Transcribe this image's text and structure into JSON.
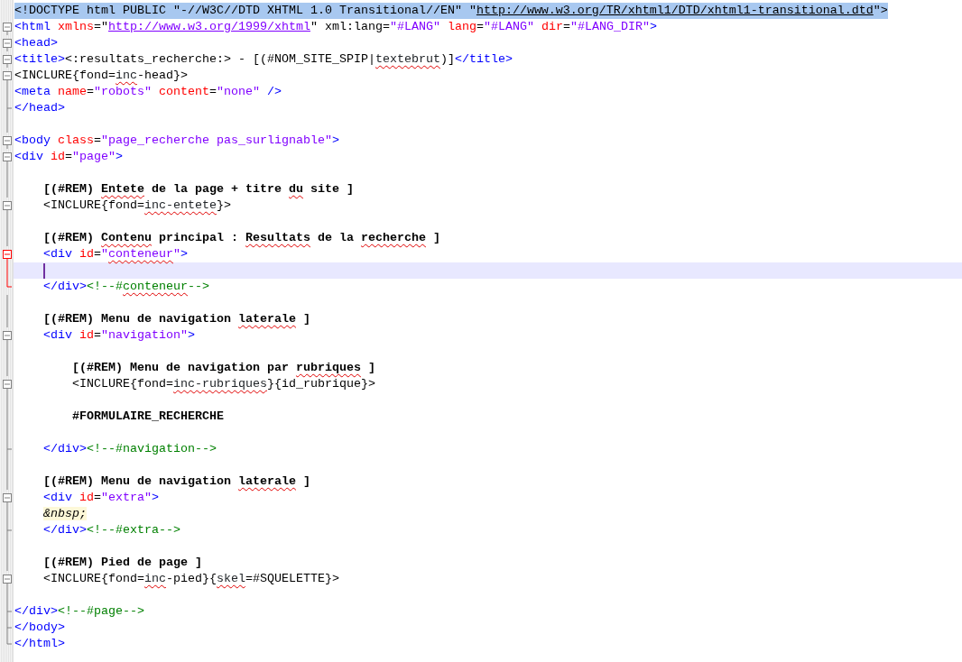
{
  "editor": {
    "lines": [
      {
        "kind": "none",
        "selected": true,
        "current": false,
        "tokens": [
          {
            "kind": "plain",
            "text": "<!DOCTYPE html PUBLIC \"-//W3C//DTD XHTML 1.0 Transitional//EN\" \""
          },
          {
            "kind": "link",
            "text": "http://www.w3.org/TR/xhtml1/DTD/xhtml1-transitional.dtd"
          },
          {
            "kind": "plain",
            "text": "\">"
          }
        ]
      },
      {
        "kind": "open",
        "selected": false,
        "current": false,
        "tokens": [
          {
            "kind": "tag",
            "text": "<html"
          },
          {
            "kind": "attr",
            "text": " xmlns"
          },
          {
            "kind": "plain",
            "text": "=\""
          },
          {
            "kind": "urlstring",
            "text": "http://www.w3.org/1999/xhtml"
          },
          {
            "kind": "plain",
            "text": "\" xml:lang="
          },
          {
            "kind": "string",
            "text": "\"#LANG\""
          },
          {
            "kind": "attr",
            "text": " lang"
          },
          {
            "kind": "plain",
            "text": "="
          },
          {
            "kind": "string",
            "text": "\"#LANG\""
          },
          {
            "kind": "attr",
            "text": " dir"
          },
          {
            "kind": "plain",
            "text": "="
          },
          {
            "kind": "string",
            "text": "\"#LANG_DIR\""
          },
          {
            "kind": "tag",
            "text": ">"
          }
        ]
      },
      {
        "kind": "open",
        "selected": false,
        "current": false,
        "tokens": [
          {
            "kind": "tag",
            "text": "<head>"
          }
        ]
      },
      {
        "kind": "open",
        "selected": false,
        "current": false,
        "tokens": [
          {
            "kind": "tag",
            "text": "<title>"
          },
          {
            "kind": "plain",
            "text": "<:resultats_recherche:> - [(#NOM_SITE_SPIP|"
          },
          {
            "kind": "typo",
            "text": "textebrut"
          },
          {
            "kind": "plain",
            "text": ")]"
          },
          {
            "kind": "tag",
            "text": "</title>"
          }
        ]
      },
      {
        "kind": "open",
        "selected": false,
        "current": false,
        "tokens": [
          {
            "kind": "plain",
            "text": "<INCLURE{fond="
          },
          {
            "kind": "typo",
            "text": "inc"
          },
          {
            "kind": "plain",
            "text": "-head}>"
          }
        ]
      },
      {
        "kind": "line",
        "selected": false,
        "current": false,
        "tokens": [
          {
            "kind": "tag",
            "text": "<meta"
          },
          {
            "kind": "attr",
            "text": " name"
          },
          {
            "kind": "plain",
            "text": "="
          },
          {
            "kind": "string",
            "text": "\"robots\""
          },
          {
            "kind": "attr",
            "text": " content"
          },
          {
            "kind": "plain",
            "text": "="
          },
          {
            "kind": "string",
            "text": "\"none\""
          },
          {
            "kind": "tag",
            "text": " />"
          }
        ]
      },
      {
        "kind": "tick",
        "selected": false,
        "current": false,
        "tokens": [
          {
            "kind": "tag",
            "text": "</head>"
          }
        ]
      },
      {
        "kind": "line",
        "selected": false,
        "current": false
      },
      {
        "kind": "open",
        "selected": false,
        "current": false,
        "tokens": [
          {
            "kind": "tag",
            "text": "<body"
          },
          {
            "kind": "attr",
            "text": " class"
          },
          {
            "kind": "plain",
            "text": "="
          },
          {
            "kind": "string",
            "text": "\"page_recherche pas_surlignable\""
          },
          {
            "kind": "tag",
            "text": ">"
          }
        ]
      },
      {
        "kind": "open",
        "selected": false,
        "current": false,
        "tokens": [
          {
            "kind": "tag",
            "text": "<div"
          },
          {
            "kind": "attr",
            "text": " id"
          },
          {
            "kind": "plain",
            "text": "="
          },
          {
            "kind": "string",
            "text": "\"page\""
          },
          {
            "kind": "tag",
            "text": ">"
          }
        ]
      },
      {
        "kind": "line",
        "selected": false,
        "current": false
      },
      {
        "kind": "line",
        "selected": false,
        "current": false,
        "tokens": [
          {
            "kind": "bold",
            "text": "    [(#REM) "
          },
          {
            "kind": "typobold",
            "text": "Entete"
          },
          {
            "kind": "bold",
            "text": " de la page + titre "
          },
          {
            "kind": "typobold",
            "text": "du"
          },
          {
            "kind": "bold",
            "text": " site ]"
          }
        ]
      },
      {
        "kind": "open",
        "selected": false,
        "current": false,
        "tokens": [
          {
            "kind": "plain",
            "text": "    <INCLURE{fond="
          },
          {
            "kind": "typo",
            "text": "inc-entete"
          },
          {
            "kind": "plain",
            "text": "}>"
          }
        ]
      },
      {
        "kind": "line",
        "selected": false,
        "current": false
      },
      {
        "kind": "line",
        "selected": false,
        "current": false,
        "tokens": [
          {
            "kind": "bold",
            "text": "    [(#REM) "
          },
          {
            "kind": "typobold",
            "text": "Contenu"
          },
          {
            "kind": "bold",
            "text": " principal : "
          },
          {
            "kind": "typobold",
            "text": "Resultats"
          },
          {
            "kind": "bold",
            "text": " de la "
          },
          {
            "kind": "typobold",
            "text": "recherche"
          },
          {
            "kind": "bold",
            "text": " ]"
          }
        ]
      },
      {
        "kind": "openactive",
        "selected": false,
        "current": false,
        "tokens": [
          {
            "kind": "tag",
            "text": "    <div"
          },
          {
            "kind": "attr",
            "text": " id"
          },
          {
            "kind": "plain",
            "text": "="
          },
          {
            "kind": "string",
            "text": "\""
          },
          {
            "kind": "typostring",
            "text": "conteneur"
          },
          {
            "kind": "string",
            "text": "\""
          },
          {
            "kind": "tag",
            "text": ">"
          }
        ]
      },
      {
        "kind": "lineactive",
        "selected": false,
        "current": true
      },
      {
        "kind": "endactive",
        "selected": false,
        "current": false,
        "tokens": [
          {
            "kind": "tag",
            "text": "    </div>"
          },
          {
            "kind": "comment",
            "text": "<!--#"
          },
          {
            "kind": "typocomment",
            "text": "conteneur"
          },
          {
            "kind": "comment",
            "text": "-->"
          }
        ]
      },
      {
        "kind": "line",
        "selected": false,
        "current": false
      },
      {
        "kind": "line",
        "selected": false,
        "current": false,
        "tokens": [
          {
            "kind": "bold",
            "text": "    [(#REM) Menu de navigation "
          },
          {
            "kind": "typobold",
            "text": "laterale"
          },
          {
            "kind": "bold",
            "text": " ]"
          }
        ]
      },
      {
        "kind": "open",
        "selected": false,
        "current": false,
        "tokens": [
          {
            "kind": "tag",
            "text": "    <div"
          },
          {
            "kind": "attr",
            "text": " id"
          },
          {
            "kind": "plain",
            "text": "="
          },
          {
            "kind": "string",
            "text": "\"navigation\""
          },
          {
            "kind": "tag",
            "text": ">"
          }
        ]
      },
      {
        "kind": "line",
        "selected": false,
        "current": false
      },
      {
        "kind": "line",
        "selected": false,
        "current": false,
        "tokens": [
          {
            "kind": "bold",
            "text": "        [(#REM) Menu de navigation par "
          },
          {
            "kind": "typobold",
            "text": "rubriques"
          },
          {
            "kind": "bold",
            "text": " ]"
          }
        ]
      },
      {
        "kind": "open",
        "selected": false,
        "current": false,
        "tokens": [
          {
            "kind": "plain",
            "text": "        <INCLURE{fond="
          },
          {
            "kind": "typo",
            "text": "inc-rubriques"
          },
          {
            "kind": "plain",
            "text": "}{id_rubrique}>"
          }
        ]
      },
      {
        "kind": "line",
        "selected": false,
        "current": false
      },
      {
        "kind": "line",
        "selected": false,
        "current": false,
        "tokens": [
          {
            "kind": "bold",
            "text": "        #FORMULAIRE_RECHERCHE"
          }
        ]
      },
      {
        "kind": "line",
        "selected": false,
        "current": false
      },
      {
        "kind": "tick",
        "selected": false,
        "current": false,
        "tokens": [
          {
            "kind": "tag",
            "text": "    </div>"
          },
          {
            "kind": "comment",
            "text": "<!--#navigation-->"
          }
        ]
      },
      {
        "kind": "line",
        "selected": false,
        "current": false
      },
      {
        "kind": "line",
        "selected": false,
        "current": false,
        "tokens": [
          {
            "kind": "bold",
            "text": "    [(#REM) Menu de navigation "
          },
          {
            "kind": "typobold",
            "text": "laterale"
          },
          {
            "kind": "bold",
            "text": " ]"
          }
        ]
      },
      {
        "kind": "open",
        "selected": false,
        "current": false,
        "tokens": [
          {
            "kind": "tag",
            "text": "    <div"
          },
          {
            "kind": "attr",
            "text": " id"
          },
          {
            "kind": "plain",
            "text": "="
          },
          {
            "kind": "string",
            "text": "\"extra\""
          },
          {
            "kind": "tag",
            "text": ">"
          }
        ]
      },
      {
        "kind": "line",
        "selected": false,
        "current": false,
        "tokens": [
          {
            "kind": "entity",
            "text": "    &nbsp;"
          }
        ]
      },
      {
        "kind": "tick",
        "selected": false,
        "current": false,
        "tokens": [
          {
            "kind": "tag",
            "text": "    </div>"
          },
          {
            "kind": "comment",
            "text": "<!--#extra-->"
          }
        ]
      },
      {
        "kind": "line",
        "selected": false,
        "current": false
      },
      {
        "kind": "line",
        "selected": false,
        "current": false,
        "tokens": [
          {
            "kind": "bold",
            "text": "    [(#REM) Pied de page ]"
          }
        ]
      },
      {
        "kind": "open",
        "selected": false,
        "current": false,
        "tokens": [
          {
            "kind": "plain",
            "text": "    <INCLURE{fond="
          },
          {
            "kind": "typo",
            "text": "inc"
          },
          {
            "kind": "plain",
            "text": "-pied}{"
          },
          {
            "kind": "typo",
            "text": "skel"
          },
          {
            "kind": "plain",
            "text": "=#SQUELETTE}>"
          }
        ]
      },
      {
        "kind": "line",
        "selected": false,
        "current": false
      },
      {
        "kind": "tick",
        "selected": false,
        "current": false,
        "tokens": [
          {
            "kind": "tag",
            "text": "</div>"
          },
          {
            "kind": "comment",
            "text": "<!--#page-->"
          }
        ]
      },
      {
        "kind": "tick",
        "selected": false,
        "current": false,
        "tokens": [
          {
            "kind": "tag",
            "text": "</body>"
          }
        ]
      },
      {
        "kind": "end",
        "selected": false,
        "current": false,
        "tokens": [
          {
            "kind": "tag",
            "text": "</html>"
          }
        ]
      }
    ]
  }
}
